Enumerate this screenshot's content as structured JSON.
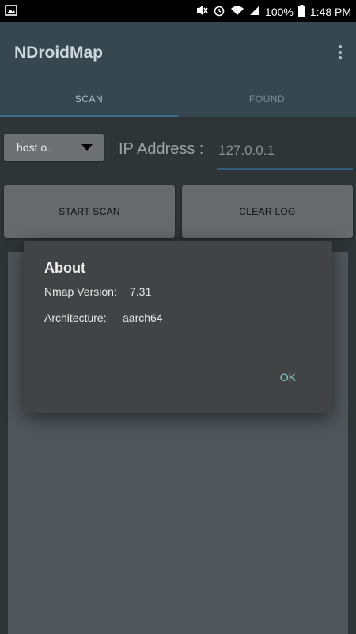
{
  "status_bar": {
    "battery": "100%",
    "time": "1:48 PM",
    "icons": [
      "image-icon",
      "mute-icon",
      "alarm-icon",
      "wifi-icon",
      "signal-icon",
      "battery-icon"
    ]
  },
  "app_bar": {
    "title": "NDroidMap",
    "tabs": [
      {
        "label": "SCAN",
        "selected": true
      },
      {
        "label": "FOUND",
        "selected": false
      }
    ]
  },
  "controls": {
    "scan_type": "host o..",
    "ip_label": "IP Address :",
    "ip_value": "127.0.0.1",
    "start_label": "START SCAN",
    "clear_label": "CLEAR LOG"
  },
  "dialog": {
    "title": "About",
    "nmap_version_label": "Nmap Version:",
    "nmap_version_value": "7.31",
    "architecture_label": "Architecture:",
    "architecture_value": "aarch64",
    "ok_label": "OK"
  },
  "colors": {
    "app_bar": "#37474f",
    "tab_indicator": "#3b6f87",
    "dialog_bg": "#424344",
    "dialog_button": "#80cbc4"
  }
}
